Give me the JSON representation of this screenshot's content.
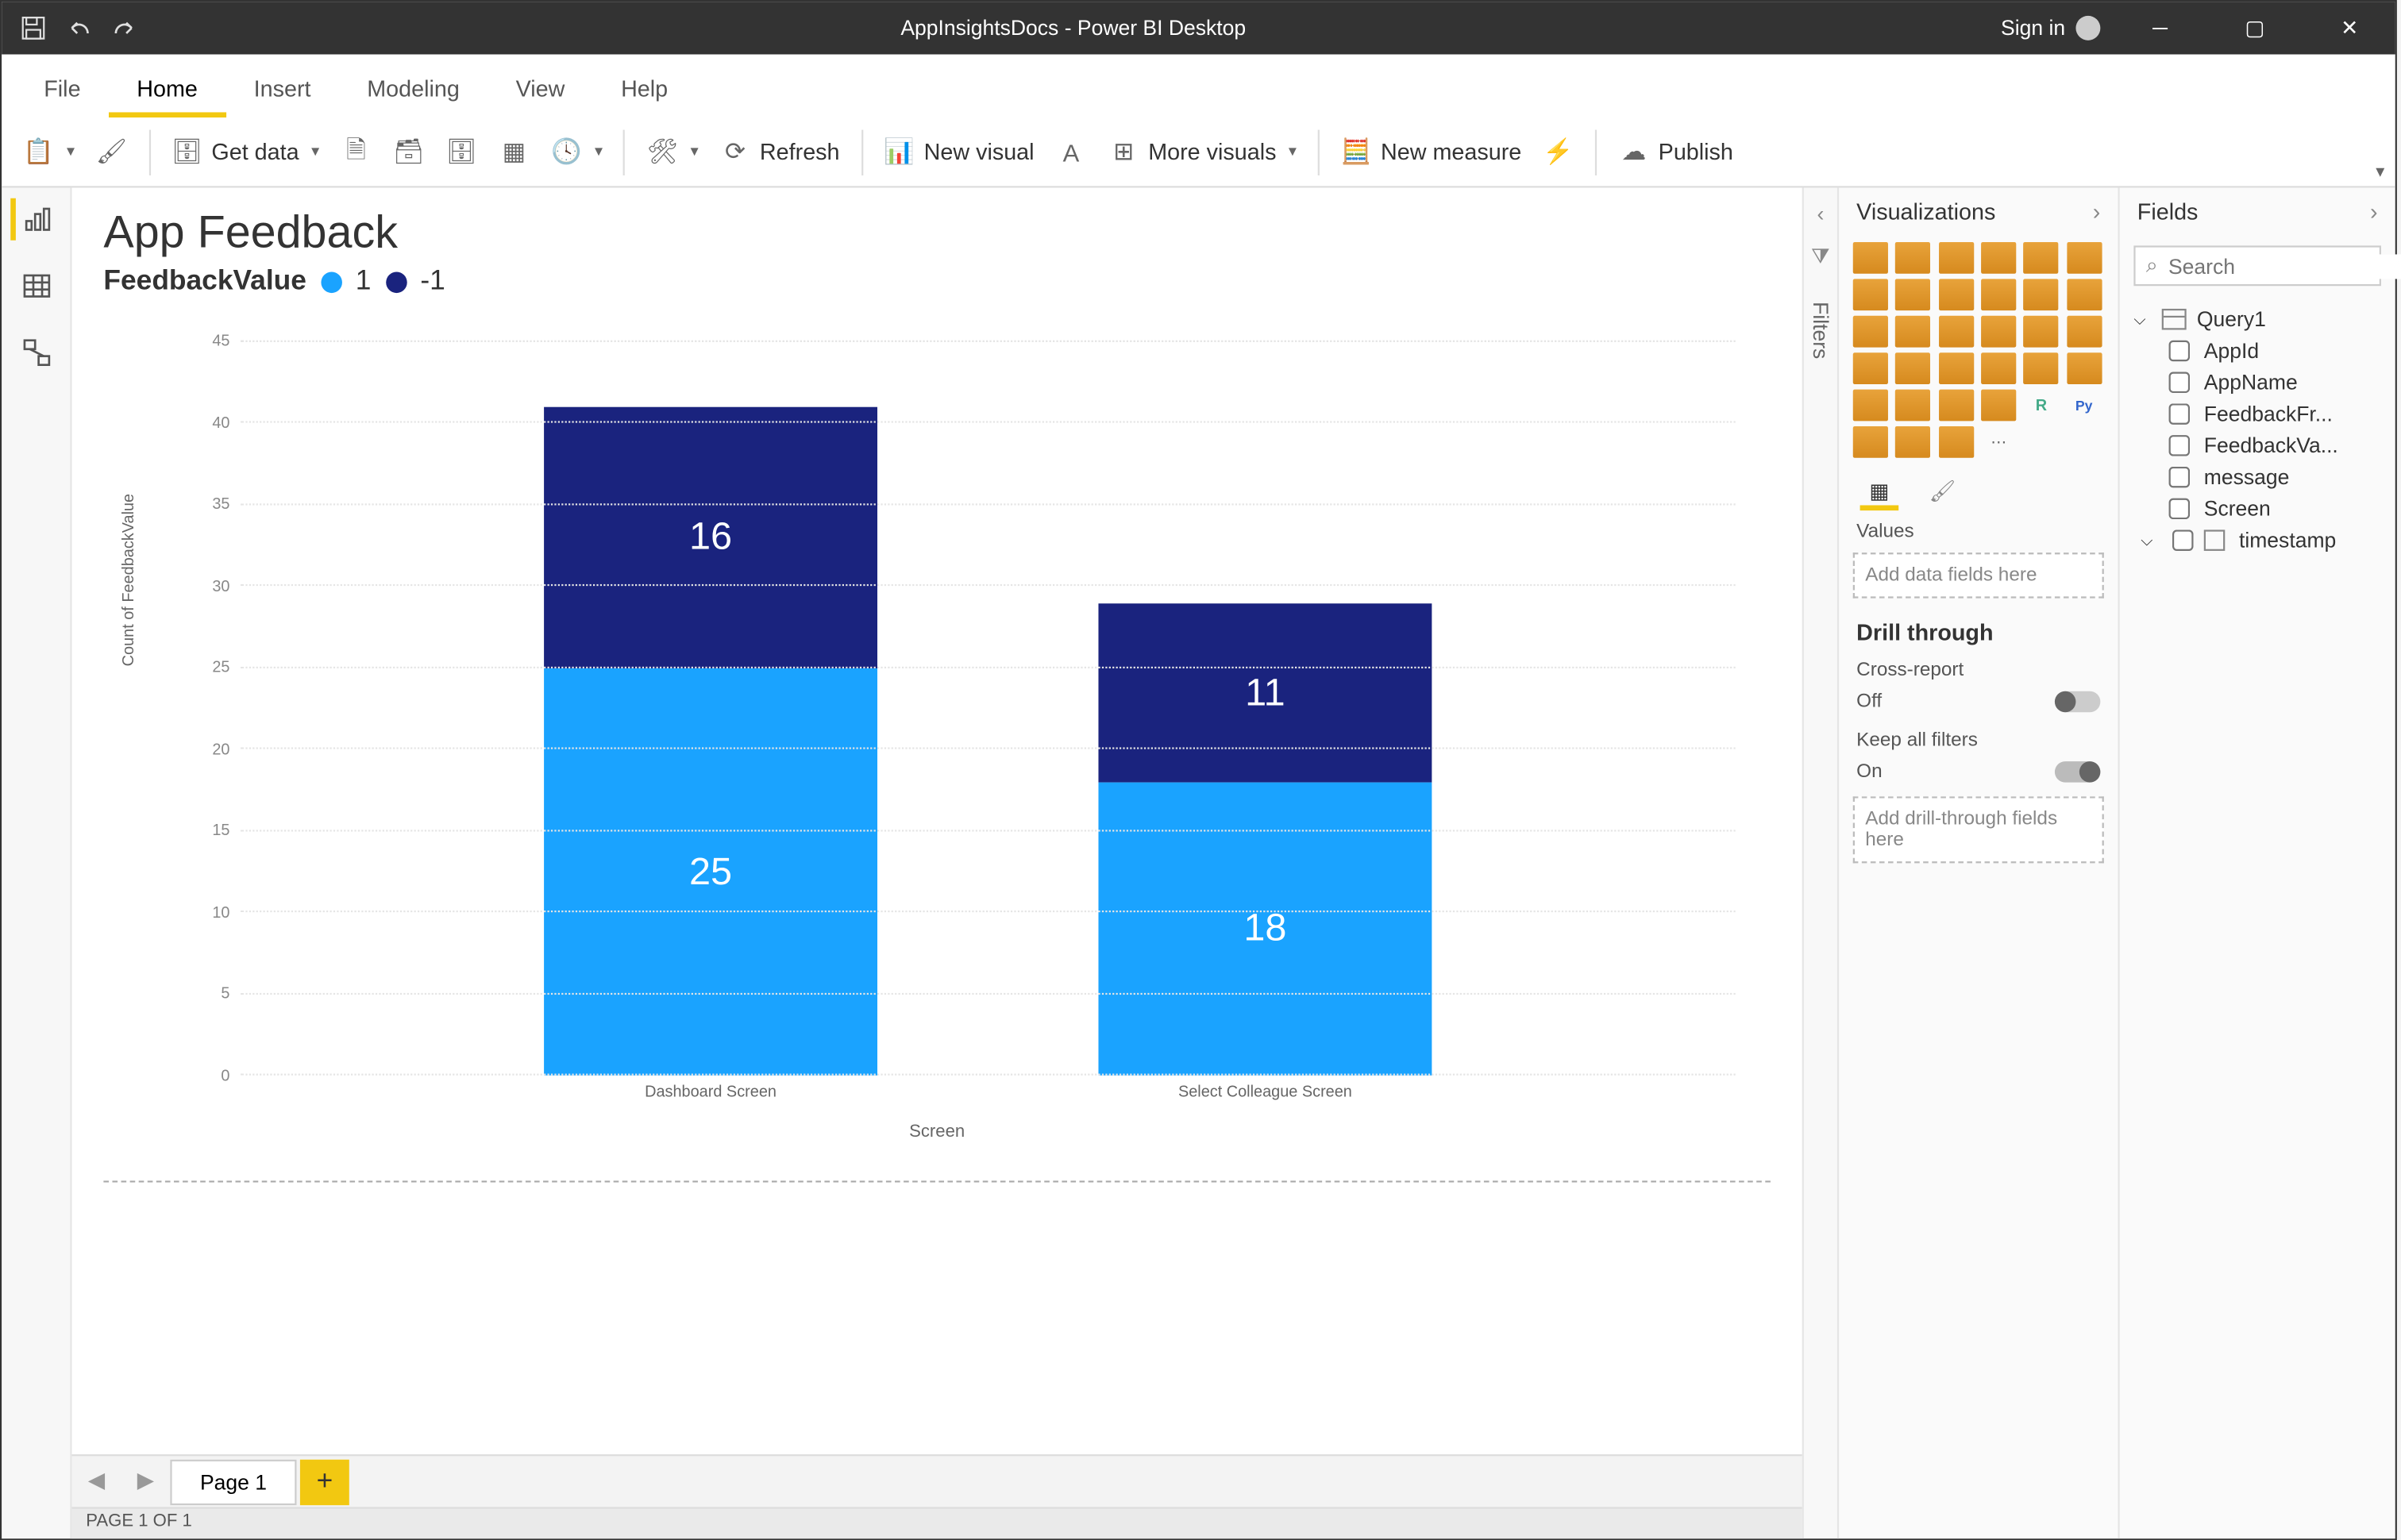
{
  "window": {
    "title": "AppInsightsDocs - Power BI Desktop",
    "signin": "Sign in"
  },
  "menu": {
    "tabs": [
      "File",
      "Home",
      "Insert",
      "Modeling",
      "View",
      "Help"
    ],
    "active": 1
  },
  "ribbon": {
    "getdata": "Get data",
    "refresh": "Refresh",
    "newvisual": "New visual",
    "morevisuals": "More visuals",
    "newmeasure": "New measure",
    "publish": "Publish"
  },
  "report": {
    "title": "App Feedback",
    "legend_title": "FeedbackValue",
    "series": [
      {
        "name": "1",
        "color": "#1aa3ff"
      },
      {
        "name": "-1",
        "color": "#1a237e"
      }
    ]
  },
  "chart_data": {
    "type": "bar",
    "stacked": true,
    "title": "App Feedback",
    "xlabel": "Screen",
    "ylabel": "Count of FeedbackValue",
    "ylim": [
      0,
      45
    ],
    "yticks": [
      0,
      5,
      10,
      15,
      20,
      25,
      30,
      35,
      40,
      45
    ],
    "categories": [
      "Dashboard Screen",
      "Select Colleague Screen"
    ],
    "series": [
      {
        "name": "1",
        "color": "#1aa3ff",
        "values": [
          25,
          18
        ]
      },
      {
        "name": "-1",
        "color": "#1a237e",
        "values": [
          16,
          11
        ]
      }
    ]
  },
  "pages": {
    "current": "Page 1",
    "status": "PAGE 1 OF 1"
  },
  "filters": {
    "label": "Filters"
  },
  "viz": {
    "header": "Visualizations",
    "values_label": "Values",
    "values_placeholder": "Add data fields here",
    "drill_header": "Drill through",
    "cross_label": "Cross-report",
    "cross_state": "Off",
    "keep_label": "Keep all filters",
    "keep_state": "On",
    "drill_placeholder": "Add drill-through fields here"
  },
  "fields": {
    "header": "Fields",
    "search_placeholder": "Search",
    "table": "Query1",
    "items": [
      "AppId",
      "AppName",
      "FeedbackFr...",
      "FeedbackVa...",
      "message",
      "Screen",
      "timestamp"
    ]
  }
}
